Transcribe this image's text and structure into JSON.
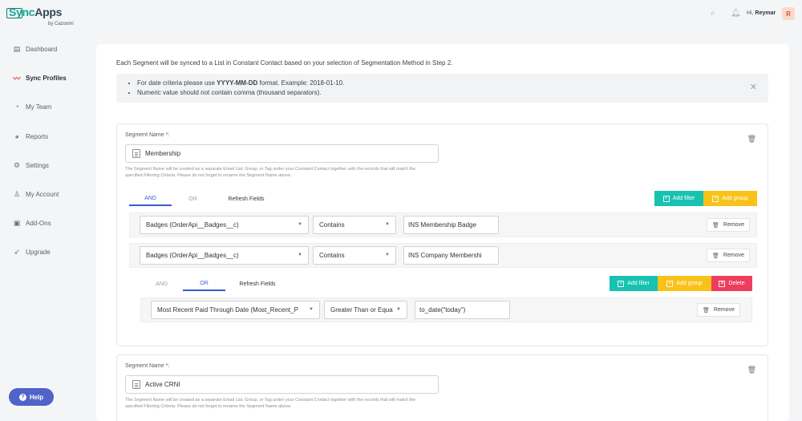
{
  "brand": {
    "name_part1": "Sync",
    "name_part2": "Apps",
    "byline": "by Cazoomi"
  },
  "sidebar": {
    "items": [
      {
        "label": "Dashboard",
        "icon": "dashboard-icon"
      },
      {
        "label": "Sync Profiles",
        "icon": "trend-icon",
        "active": true
      },
      {
        "label": "My Team",
        "icon": "team-icon"
      },
      {
        "label": "Reports",
        "icon": "reports-icon"
      },
      {
        "label": "Settings",
        "icon": "gear-icon"
      },
      {
        "label": "My Account",
        "icon": "user-icon"
      },
      {
        "label": "Add-Ons",
        "icon": "addons-icon"
      },
      {
        "label": "Upgrade",
        "icon": "rocket-icon"
      }
    ],
    "help_label": "Help"
  },
  "topbar": {
    "greeting_prefix": "Hi,",
    "user_name": "Reymar",
    "avatar_initial": "R"
  },
  "main": {
    "intro": "Each Segment will be synced to a List in Constant Contact based on your selection of Segmentation Method in Step 2.",
    "notice": {
      "line1_prefix": "For date criteria please use ",
      "line1_format": "YYYY-MM-DD",
      "line1_suffix": " format. Example: 2018-01-10.",
      "line2": "Numeric value should not contain comma (thousand separators)."
    }
  },
  "segments": [
    {
      "label": "Segment Name *:",
      "name": "Membership",
      "help": "The Segment Name will be created as a separate Email List, Group, or Tag under your Constant Contact together with the records that will match the specified Filtering Criteria. Please do not forget to rename the Segment Name above.",
      "tabs": {
        "and": "AND",
        "or": "OR",
        "refresh": "Refresh Fields"
      },
      "add_filter": "Add filter",
      "add_group": "Add group",
      "rules": [
        {
          "field": "Badges (OrderApi__Badges__c)",
          "operator": "Contains",
          "value": "INS Membership Badge",
          "remove": "Remove"
        },
        {
          "field": "Badges (OrderApi__Badges__c)",
          "operator": "Contains",
          "value": "INS Company Membershi",
          "remove": "Remove"
        }
      ],
      "group": {
        "tabs": {
          "and": "AND",
          "or": "OR",
          "refresh": "Refresh Fields"
        },
        "add_filter": "Add filter",
        "add_group": "Add group",
        "delete": "Delete",
        "rules": [
          {
            "field": "Most Recent Paid Through Date (Most_Recent_P",
            "operator": "Greater Than or Equa",
            "value": "to_date(\"today\")",
            "remove": "Remove"
          }
        ]
      }
    },
    {
      "label": "Segment Name *:",
      "name": "Active CRNI",
      "help": "The Segment Name will be created as a separate Email List, Group, or Tag under your Constant Contact together with the records that will match the specified Filtering Criteria. Please do not forget to rename the Segment Name above."
    }
  ],
  "colors": {
    "accent": "#3b5bd6",
    "teal": "#17c2b0",
    "yellow": "#f8c21a",
    "red": "#ef3d5e",
    "help": "#4f63c9"
  }
}
